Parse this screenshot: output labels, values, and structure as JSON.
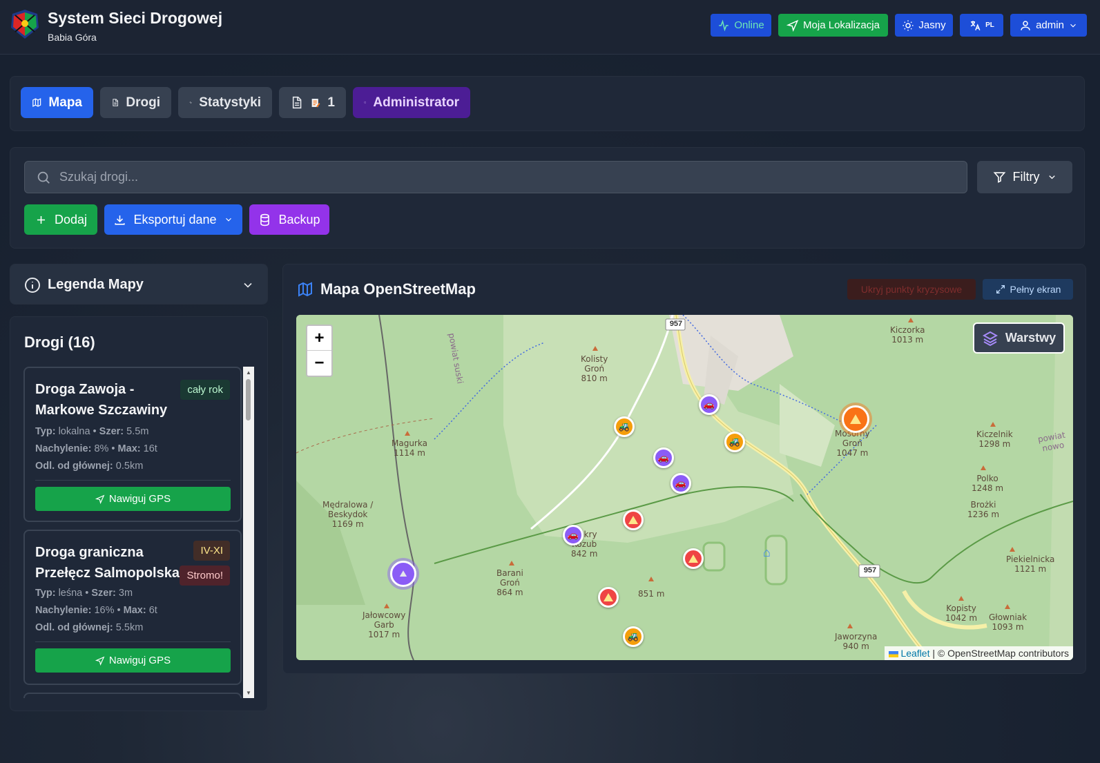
{
  "header": {
    "title": "System Sieci Drogowej",
    "subtitle": "Babia Góra",
    "status": "Online",
    "location_btn": "Moja Lokalizacja",
    "theme_btn": "Jasny",
    "lang_code": "PL",
    "user": "admin"
  },
  "tabs": {
    "map": "Mapa",
    "roads": "Drogi",
    "stats": "Statystyki",
    "reports": "1",
    "admin": "Administrator"
  },
  "search": {
    "placeholder": "Szukaj drogi...",
    "filters": "Filtry"
  },
  "actions": {
    "add": "Dodaj",
    "export": "Eksportuj dane",
    "backup": "Backup"
  },
  "legend": {
    "title": "Legenda Mapy"
  },
  "roads": {
    "title": "Drogi (16)",
    "items": [
      {
        "name": "Droga Zawoja - Markowe Szczawiny",
        "badge": "cały rok",
        "line1_label": "Typ:",
        "line1_val": "lokalna",
        "line1_label2": "Szer:",
        "line1_val2": "5.5m",
        "line2_label": "Nachylenie:",
        "line2_val": "8%",
        "line2_label2": "Max:",
        "line2_val2": "16t",
        "line3_label": "Odl. od głównej:",
        "line3_val": "0.5km",
        "nav": "Nawiguj GPS"
      },
      {
        "name": "Droga graniczna Przełęcz Salmopolska",
        "badge": "IV-XI",
        "badge2": "Stromo!",
        "line1_label": "Typ:",
        "line1_val": "leśna",
        "line1_label2": "Szer:",
        "line1_val2": "3m",
        "line2_label": "Nachylenie:",
        "line2_val": "16%",
        "line2_label2": "Max:",
        "line2_val2": "6t",
        "line3_label": "Odl. od głównej:",
        "line3_val": "5.5km",
        "nav": "Nawiguj GPS"
      }
    ]
  },
  "map": {
    "title": "Mapa OpenStreetMap",
    "hide_crisis": "Ukryj punkty kryzysowe",
    "fullscreen": "Pełny ekran",
    "layers": "Warstwy",
    "zoom_in": "+",
    "zoom_out": "−",
    "attribution_link": "Leaflet",
    "attribution_text": "| © OpenStreetMap contributors",
    "road_no_1": "957",
    "road_no_2": "957",
    "places": {
      "kiczorka": "Kiczorka",
      "kiczorka_h": "1013 m",
      "kolisty": "Kolisty",
      "kolisty2": "Groń",
      "kolisty_h": "810 m",
      "magurka": "Magurka",
      "magurka_h": "1114 m",
      "mosorny": "Mosorny",
      "mosorny2": "Groń",
      "mosorny_h": "1047 m",
      "kiczelnik": "Kiczelnik",
      "kiczelnik_h": "1298 m",
      "polko": "Polko",
      "polko_h": "1248 m",
      "brozki": "Brożki",
      "brozki_h": "1236 m",
      "medralowa": "Mędralowa /",
      "medralowa2": "Beskydok",
      "medralowa_h": "1169 m",
      "mokry": "Mokry",
      "mokry2": "Kozub",
      "mokry_h": "842 m",
      "barani": "Barani",
      "barani2": "Groń",
      "barani_h": "864 m",
      "h851": "851 m",
      "jalowcowy": "Jałowcowy",
      "jalowcowy2": "Garb",
      "jalowcowy_h": "1017 m",
      "piekielnicka": "Piekielnicka",
      "piekielnicka_h": "1121 m",
      "kopisty": "Kopisty",
      "kopisty_h": "1042 m",
      "glowniak": "Głowniak",
      "glowniak_h": "1093 m",
      "jaworzyna": "Jaworzyna",
      "jaworzyna_h": "940 m",
      "powiat": "powiat suski",
      "powiat2": "powiat nowo"
    }
  }
}
